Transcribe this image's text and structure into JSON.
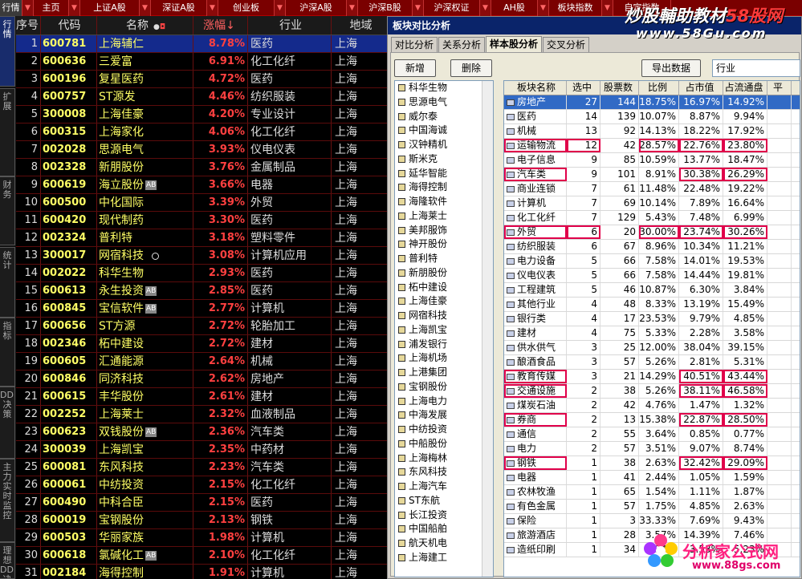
{
  "topbar": {
    "tabs": [
      "行情",
      "主页",
      "上证A股",
      "深证A股",
      "创业板",
      "沪深A股",
      "沪深B股",
      "沪深权证",
      "AH股",
      "板块指数",
      "自定指数"
    ]
  },
  "sidebar": {
    "tabs": [
      "行情",
      "扩展",
      "财务",
      "统计",
      "指标",
      "DDE决策",
      "主力实时监控",
      "理想DDE决"
    ]
  },
  "grid": {
    "headers": {
      "no": "序号",
      "code": "代码",
      "name": "名称",
      "pct": "涨幅↓",
      "industry": "行业",
      "region": "地域"
    },
    "rows": [
      {
        "no": "1",
        "code": "600781",
        "name": "上海辅仁",
        "pct": "8.78%",
        "industry": "医药",
        "region": "上海",
        "ab": false
      },
      {
        "no": "2",
        "code": "600636",
        "name": "三爱富",
        "pct": "6.91%",
        "industry": "化工化纤",
        "region": "上海",
        "ab": false
      },
      {
        "no": "3",
        "code": "600196",
        "name": "复星医药",
        "pct": "4.72%",
        "industry": "医药",
        "region": "上海",
        "ab": false
      },
      {
        "no": "4",
        "code": "600757",
        "name": "ST源发",
        "pct": "4.46%",
        "industry": "纺织服装",
        "region": "上海",
        "ab": false
      },
      {
        "no": "5",
        "code": "300008",
        "name": "上海佳豪",
        "pct": "4.20%",
        "industry": "专业设计",
        "region": "上海",
        "ab": false
      },
      {
        "no": "6",
        "code": "600315",
        "name": "上海家化",
        "pct": "4.06%",
        "industry": "化工化纤",
        "region": "上海",
        "ab": false
      },
      {
        "no": "7",
        "code": "002028",
        "name": "思源电气",
        "pct": "3.93%",
        "industry": "仪电仪表",
        "region": "上海",
        "ab": false
      },
      {
        "no": "8",
        "code": "002328",
        "name": "新朋股份",
        "pct": "3.76%",
        "industry": "金属制品",
        "region": "上海",
        "ab": false
      },
      {
        "no": "9",
        "code": "600619",
        "name": "海立股份",
        "pct": "3.66%",
        "industry": "电器",
        "region": "上海",
        "ab": true
      },
      {
        "no": "10",
        "code": "600500",
        "name": "中化国际",
        "pct": "3.39%",
        "industry": "外贸",
        "region": "上海",
        "ab": false
      },
      {
        "no": "11",
        "code": "600420",
        "name": "现代制药",
        "pct": "3.30%",
        "industry": "医药",
        "region": "上海",
        "ab": false
      },
      {
        "no": "12",
        "code": "002324",
        "name": "普利特",
        "pct": "3.18%",
        "industry": "塑料零件",
        "region": "上海",
        "ab": false
      },
      {
        "no": "13",
        "code": "300017",
        "name": "网宿科技",
        "pct": "3.08%",
        "industry": "计算机应用",
        "region": "上海",
        "ab": false
      },
      {
        "no": "14",
        "code": "002022",
        "name": "科华生物",
        "pct": "2.93%",
        "industry": "医药",
        "region": "上海",
        "ab": false
      },
      {
        "no": "15",
        "code": "600613",
        "name": "永生投资",
        "pct": "2.85%",
        "industry": "医药",
        "region": "上海",
        "ab": true
      },
      {
        "no": "16",
        "code": "600845",
        "name": "宝信软件",
        "pct": "2.77%",
        "industry": "计算机",
        "region": "上海",
        "ab": true
      },
      {
        "no": "17",
        "code": "600656",
        "name": "ST方源",
        "pct": "2.72%",
        "industry": "轮胎加工",
        "region": "上海",
        "ab": false
      },
      {
        "no": "18",
        "code": "002346",
        "name": "柘中建设",
        "pct": "2.72%",
        "industry": "建材",
        "region": "上海",
        "ab": false
      },
      {
        "no": "19",
        "code": "600605",
        "name": "汇通能源",
        "pct": "2.64%",
        "industry": "机械",
        "region": "上海",
        "ab": false
      },
      {
        "no": "20",
        "code": "600846",
        "name": "同济科技",
        "pct": "2.62%",
        "industry": "房地产",
        "region": "上海",
        "ab": false
      },
      {
        "no": "21",
        "code": "600615",
        "name": "丰华股份",
        "pct": "2.61%",
        "industry": "建材",
        "region": "上海",
        "ab": false
      },
      {
        "no": "22",
        "code": "002252",
        "name": "上海莱士",
        "pct": "2.32%",
        "industry": "血液制品",
        "region": "上海",
        "ab": false
      },
      {
        "no": "23",
        "code": "600623",
        "name": "双钱股份",
        "pct": "2.36%",
        "industry": "汽车类",
        "region": "上海",
        "ab": true
      },
      {
        "no": "24",
        "code": "300039",
        "name": "上海凯宝",
        "pct": "2.35%",
        "industry": "中药材",
        "region": "上海",
        "ab": false
      },
      {
        "no": "25",
        "code": "600081",
        "name": "东风科技",
        "pct": "2.23%",
        "industry": "汽车类",
        "region": "上海",
        "ab": false
      },
      {
        "no": "26",
        "code": "600061",
        "name": "中纺投资",
        "pct": "2.15%",
        "industry": "化工化纤",
        "region": "上海",
        "ab": false
      },
      {
        "no": "27",
        "code": "600490",
        "name": "中科合臣",
        "pct": "2.15%",
        "industry": "医药",
        "region": "上海",
        "ab": false
      },
      {
        "no": "28",
        "code": "600019",
        "name": "宝钢股份",
        "pct": "2.13%",
        "industry": "钢铁",
        "region": "上海",
        "ab": false
      },
      {
        "no": "29",
        "code": "600503",
        "name": "华丽家族",
        "pct": "1.98%",
        "industry": "计算机",
        "region": "上海",
        "ab": false
      },
      {
        "no": "30",
        "code": "600618",
        "name": "氯碱化工",
        "pct": "2.10%",
        "industry": "化工化纤",
        "region": "上海",
        "ab": true
      },
      {
        "no": "31",
        "code": "002184",
        "name": "海得控制",
        "pct": "1.91%",
        "industry": "计算机",
        "region": "上海",
        "ab": false
      }
    ]
  },
  "dialog": {
    "title": "板块对比分析",
    "tabs": [
      "对比分析",
      "关系分析",
      "样本股分析",
      "交叉分析"
    ],
    "buttons": {
      "add": "新增",
      "delete": "删除",
      "export": "导出数据"
    },
    "combo_value": "行业",
    "stock_list": [
      "科华生物",
      "思源电气",
      "威尔泰",
      "中国海诚",
      "汉钟精机",
      "斯米克",
      "延华智能",
      "海得控制",
      "海隆软件",
      "上海莱士",
      "美邦服饰",
      "神开股份",
      "普利特",
      "新朋股份",
      "柘中建设",
      "上海佳豪",
      "网宿科技",
      "上海凯宝",
      "浦发银行",
      "上海机场",
      "上港集团",
      "宝钢股份",
      "上海电力",
      "中海发展",
      "中纺投资",
      "中船股份",
      "上海梅林",
      "东风科技",
      "上海汽车",
      "ST东航",
      "长江投资",
      "中国船舶",
      "航天机电",
      "上海建工"
    ],
    "table_headers": {
      "name": "板块名称",
      "selected": "选中",
      "count": "股票数",
      "ratio": "比例",
      "cap": "占市值",
      "float": "占流通盘",
      "avg": "平"
    },
    "rows": [
      {
        "name": "房地产",
        "selected": "27",
        "count": "144",
        "ratio": "18.75%",
        "cap": "16.97%",
        "float": "14.92%",
        "hl": []
      },
      {
        "name": "医药",
        "selected": "14",
        "count": "139",
        "ratio": "10.07%",
        "cap": "8.87%",
        "float": "9.94%",
        "hl": []
      },
      {
        "name": "机械",
        "selected": "13",
        "count": "92",
        "ratio": "14.13%",
        "cap": "18.22%",
        "float": "17.92%",
        "hl": []
      },
      {
        "name": "运输物流",
        "selected": "12",
        "count": "42",
        "ratio": "28.57%",
        "cap": "22.76%",
        "float": "23.80%",
        "hl": [
          "name",
          "selected",
          "ratio",
          "cap",
          "float"
        ]
      },
      {
        "name": "电子信息",
        "selected": "9",
        "count": "85",
        "ratio": "10.59%",
        "cap": "13.77%",
        "float": "18.47%",
        "hl": []
      },
      {
        "name": "汽车类",
        "selected": "9",
        "count": "101",
        "ratio": "8.91%",
        "cap": "30.38%",
        "float": "26.29%",
        "hl": [
          "name",
          "cap",
          "float"
        ]
      },
      {
        "name": "商业连锁",
        "selected": "7",
        "count": "61",
        "ratio": "11.48%",
        "cap": "22.48%",
        "float": "19.22%",
        "hl": []
      },
      {
        "name": "计算机",
        "selected": "7",
        "count": "69",
        "ratio": "10.14%",
        "cap": "7.89%",
        "float": "16.64%",
        "hl": []
      },
      {
        "name": "化工化纤",
        "selected": "7",
        "count": "129",
        "ratio": "5.43%",
        "cap": "7.48%",
        "float": "6.99%",
        "hl": []
      },
      {
        "name": "外贸",
        "selected": "6",
        "count": "20",
        "ratio": "30.00%",
        "cap": "23.74%",
        "float": "30.26%",
        "hl": [
          "name",
          "selected",
          "ratio",
          "cap",
          "float"
        ]
      },
      {
        "name": "纺织服装",
        "selected": "6",
        "count": "67",
        "ratio": "8.96%",
        "cap": "10.34%",
        "float": "11.21%",
        "hl": []
      },
      {
        "name": "电力设备",
        "selected": "5",
        "count": "66",
        "ratio": "7.58%",
        "cap": "14.01%",
        "float": "19.53%",
        "hl": []
      },
      {
        "name": "仪电仪表",
        "selected": "5",
        "count": "66",
        "ratio": "7.58%",
        "cap": "14.44%",
        "float": "19.81%",
        "hl": []
      },
      {
        "name": "工程建筑",
        "selected": "5",
        "count": "46",
        "ratio": "10.87%",
        "cap": "6.30%",
        "float": "3.84%",
        "hl": []
      },
      {
        "name": "其他行业",
        "selected": "4",
        "count": "48",
        "ratio": "8.33%",
        "cap": "13.19%",
        "float": "15.49%",
        "hl": []
      },
      {
        "name": "银行类",
        "selected": "4",
        "count": "17",
        "ratio": "23.53%",
        "cap": "9.79%",
        "float": "4.85%",
        "hl": []
      },
      {
        "name": "建材",
        "selected": "4",
        "count": "75",
        "ratio": "5.33%",
        "cap": "2.28%",
        "float": "3.58%",
        "hl": []
      },
      {
        "name": "供水供气",
        "selected": "3",
        "count": "25",
        "ratio": "12.00%",
        "cap": "38.04%",
        "float": "39.15%",
        "hl": []
      },
      {
        "name": "酿酒食品",
        "selected": "3",
        "count": "57",
        "ratio": "5.26%",
        "cap": "2.81%",
        "float": "5.31%",
        "hl": []
      },
      {
        "name": "教育传媒",
        "selected": "3",
        "count": "21",
        "ratio": "14.29%",
        "cap": "40.51%",
        "float": "43.44%",
        "hl": [
          "name",
          "cap",
          "float"
        ]
      },
      {
        "name": "交通设施",
        "selected": "2",
        "count": "38",
        "ratio": "5.26%",
        "cap": "38.11%",
        "float": "46.58%",
        "hl": [
          "name",
          "cap",
          "float"
        ]
      },
      {
        "name": "煤炭石油",
        "selected": "2",
        "count": "42",
        "ratio": "4.76%",
        "cap": "1.47%",
        "float": "1.32%",
        "hl": []
      },
      {
        "name": "券商",
        "selected": "2",
        "count": "13",
        "ratio": "15.38%",
        "cap": "22.87%",
        "float": "28.50%",
        "hl": [
          "name",
          "cap",
          "float"
        ]
      },
      {
        "name": "通信",
        "selected": "2",
        "count": "55",
        "ratio": "3.64%",
        "cap": "0.85%",
        "float": "0.77%",
        "hl": []
      },
      {
        "name": "电力",
        "selected": "2",
        "count": "57",
        "ratio": "3.51%",
        "cap": "9.07%",
        "float": "8.74%",
        "hl": []
      },
      {
        "name": "钢铁",
        "selected": "1",
        "count": "38",
        "ratio": "2.63%",
        "cap": "32.42%",
        "float": "29.09%",
        "hl": [
          "name",
          "cap",
          "float"
        ]
      },
      {
        "name": "电器",
        "selected": "1",
        "count": "41",
        "ratio": "2.44%",
        "cap": "1.05%",
        "float": "1.59%",
        "hl": []
      },
      {
        "name": "农林牧渔",
        "selected": "1",
        "count": "65",
        "ratio": "1.54%",
        "cap": "1.11%",
        "float": "1.87%",
        "hl": []
      },
      {
        "name": "有色金属",
        "selected": "1",
        "count": "57",
        "ratio": "1.75%",
        "cap": "4.85%",
        "float": "2.63%",
        "hl": []
      },
      {
        "name": "保险",
        "selected": "1",
        "count": "3",
        "ratio": "33.33%",
        "cap": "7.69%",
        "float": "9.43%",
        "hl": []
      },
      {
        "name": "旅游酒店",
        "selected": "1",
        "count": "28",
        "ratio": "3.57%",
        "cap": "14.39%",
        "float": "7.46%",
        "hl": []
      },
      {
        "name": "造纸印刷",
        "selected": "1",
        "count": "34",
        "ratio": "2.94%",
        "cap": "3.53%",
        "float": "5.23%",
        "hl": []
      }
    ]
  },
  "watermarks": {
    "top_line1": "炒股輔助教材",
    "top_line1_brand": "58股网",
    "top_line2": "www.58Gu.com",
    "bottom_line1": "分析家公式网",
    "bottom_line2": "www.88gs.com"
  },
  "colors": {
    "highlight": "#e0004a",
    "selected_row": "#142a8c",
    "gain": "#ff4040",
    "code": "#ffff66"
  }
}
